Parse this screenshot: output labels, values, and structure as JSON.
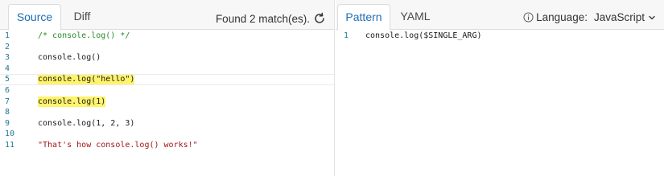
{
  "source_pane": {
    "tabs": [
      {
        "label": "Source",
        "active": true
      },
      {
        "label": "Diff",
        "active": false
      }
    ],
    "match_text": "Found 2 match(es).",
    "lines": [
      {
        "num": "1",
        "text": "/* console.log() */",
        "kind": "comment",
        "highlight": false
      },
      {
        "num": "2",
        "text": "",
        "kind": "code",
        "highlight": false
      },
      {
        "num": "3",
        "text": "console.log()",
        "kind": "code",
        "highlight": false
      },
      {
        "num": "4",
        "text": "",
        "kind": "code",
        "highlight": false
      },
      {
        "num": "5",
        "text": "console.log(\"hello\")",
        "kind": "code",
        "highlight": true,
        "current": true
      },
      {
        "num": "6",
        "text": "",
        "kind": "code",
        "highlight": false
      },
      {
        "num": "7",
        "text": "console.log(1)",
        "kind": "code",
        "highlight": true
      },
      {
        "num": "8",
        "text": "",
        "kind": "code",
        "highlight": false
      },
      {
        "num": "9",
        "text": "console.log(1, 2, 3)",
        "kind": "code",
        "highlight": false
      },
      {
        "num": "10",
        "text": "",
        "kind": "code",
        "highlight": false
      },
      {
        "num": "11",
        "text": "\"That's how console.log() works!\"",
        "kind": "string",
        "highlight": false
      }
    ]
  },
  "pattern_pane": {
    "tabs": [
      {
        "label": "Pattern",
        "active": true
      },
      {
        "label": "YAML",
        "active": false
      }
    ],
    "language_label": "Language:",
    "language_value": "JavaScript",
    "lines": [
      {
        "num": "1",
        "text": "console.log($SINGLE_ARG)"
      }
    ]
  },
  "colors": {
    "active_tab": "#1e6fb3",
    "highlight": "#fff36b",
    "line_number": "#237893",
    "comment": "#2a8a2a",
    "string": "#a31515"
  },
  "icons": {
    "refresh": "refresh-icon",
    "info": "info-icon",
    "dropdown": "chevron-down-icon"
  }
}
